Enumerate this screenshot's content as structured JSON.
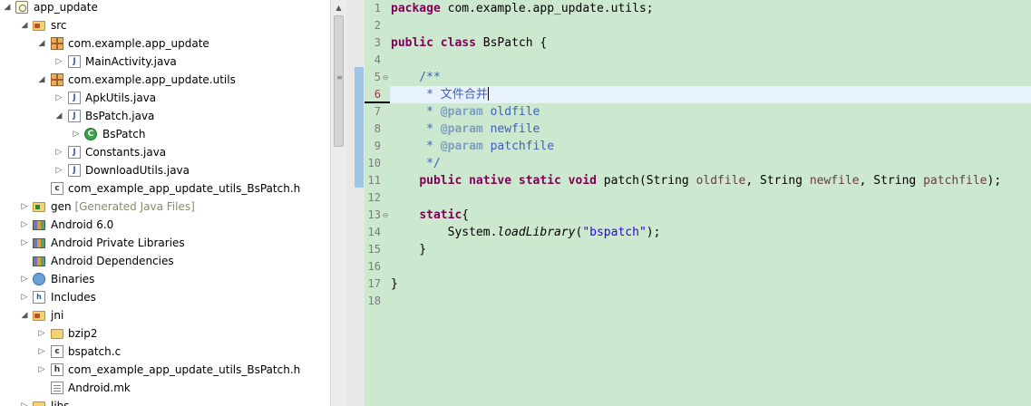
{
  "explorer": {
    "items": [
      {
        "label": "app_update",
        "icon": "project-icon",
        "expanded": true
      },
      {
        "label": "src",
        "icon": "source-folder-icon",
        "expanded": true
      },
      {
        "label": "com.example.app_update",
        "icon": "package-icon",
        "expanded": true
      },
      {
        "label": "MainActivity.java",
        "icon": "java-file-icon",
        "expanded": false
      },
      {
        "label": "com.example.app_update.utils",
        "icon": "package-icon",
        "expanded": true
      },
      {
        "label": "ApkUtils.java",
        "icon": "java-file-icon",
        "expanded": false
      },
      {
        "label": "BsPatch.java",
        "icon": "java-file-icon",
        "expanded": true
      },
      {
        "label": "BsPatch",
        "icon": "class-icon",
        "expanded": false
      },
      {
        "label": "Constants.java",
        "icon": "java-file-icon",
        "expanded": false
      },
      {
        "label": "DownloadUtils.java",
        "icon": "java-file-icon",
        "expanded": false
      },
      {
        "label": "com_example_app_update_utils_BsPatch.h",
        "icon": "c-header-icon",
        "expanded": null
      },
      {
        "label": "gen",
        "decoration": "[Generated Java Files]",
        "icon": "generated-folder-icon",
        "expanded": false
      },
      {
        "label": "Android 6.0",
        "icon": "library-icon",
        "expanded": false
      },
      {
        "label": "Android Private Libraries",
        "icon": "library-icon",
        "expanded": false
      },
      {
        "label": "Android Dependencies",
        "icon": "library-icon",
        "expanded": null
      },
      {
        "label": "Binaries",
        "icon": "binaries-icon",
        "expanded": false
      },
      {
        "label": "Includes",
        "icon": "includes-icon",
        "expanded": false
      },
      {
        "label": "jni",
        "icon": "source-folder-icon",
        "expanded": true
      },
      {
        "label": "bzip2",
        "icon": "folder-icon",
        "expanded": false
      },
      {
        "label": "bspatch.c",
        "icon": "c-file-icon",
        "expanded": false
      },
      {
        "label": "com_example_app_update_utils_BsPatch.h",
        "icon": "c-header-icon",
        "expanded": false
      },
      {
        "label": "Android.mk",
        "icon": "makefile-icon",
        "expanded": null
      },
      {
        "label": "libs",
        "icon": "folder-icon",
        "expanded": false
      }
    ]
  },
  "editor": {
    "current_line": 6,
    "line_numbers": [
      "1",
      "2",
      "3",
      "4",
      "5",
      "6",
      "7",
      "8",
      "9",
      "10",
      "11",
      "12",
      "13",
      "14",
      "15",
      "16",
      "17",
      "18"
    ],
    "code": {
      "l1_kw": "package",
      "l1_text": " com.example.app_update.utils;",
      "l3_kw1": "public",
      "l3_kw2": "class",
      "l3_text": " BsPatch {",
      "l5": "    /**",
      "l6": "     * 文件合并",
      "l7_star": "     * ",
      "l7_tag": "@param",
      "l7_name": " oldfile",
      "l8_star": "     * ",
      "l8_tag": "@param",
      "l8_name": " newfile",
      "l9_star": "     * ",
      "l9_tag": "@param",
      "l9_name": " patchfile",
      "l10": "     */",
      "l11_indent": "    ",
      "l11_kw": "public native static void",
      "l11_a": " patch(String ",
      "l11_p1": "oldfile",
      "l11_b": ", String ",
      "l11_p2": "newfile",
      "l11_c": ", String ",
      "l11_p3": "patchfile",
      "l11_d": ");",
      "l13_indent": "    ",
      "l13_kw": "static",
      "l13_text": "{",
      "l14_a": "        System.",
      "l14_method": "loadLibrary",
      "l14_b": "(",
      "l14_str": "\"bspatch\"",
      "l14_c": ");",
      "l15": "    }",
      "l17": "}"
    }
  }
}
